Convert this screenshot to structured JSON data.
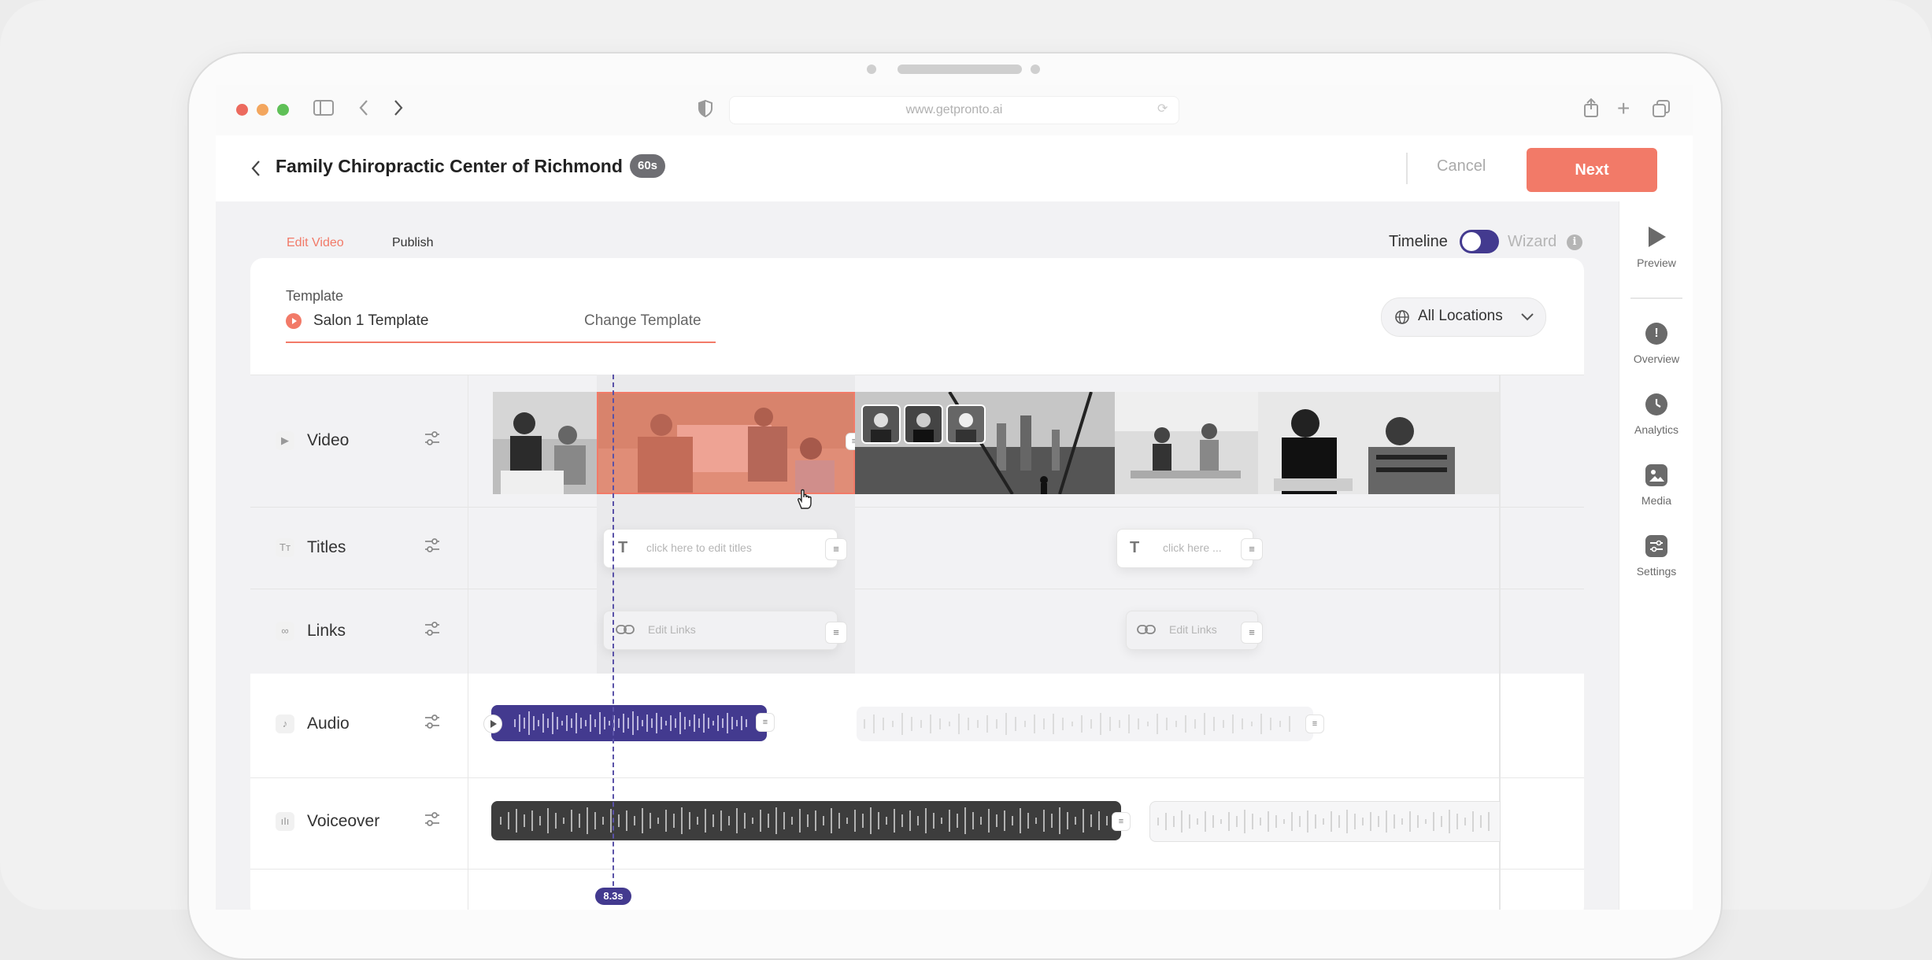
{
  "browser": {
    "url": "www.getpronto.ai"
  },
  "header": {
    "title": "Family Chiropractic Center of Richmond",
    "duration_badge": "60s",
    "cancel_label": "Cancel",
    "next_label": "Next"
  },
  "tabs": [
    {
      "label": "Edit Video",
      "active": true
    },
    {
      "label": "Publish",
      "active": false
    }
  ],
  "mode_toggle": {
    "left_label": "Timeline",
    "right_label": "Wizard",
    "on": "Timeline"
  },
  "template": {
    "heading": "Template",
    "name": "Salon 1 Template",
    "change_label": "Change Template"
  },
  "locations": {
    "label": "All Locations"
  },
  "tracks": {
    "video": {
      "label": "Video"
    },
    "titles": {
      "label": "Titles",
      "chip1": "click here to edit titles",
      "chip2": "click here ..."
    },
    "links": {
      "label": "Links",
      "chip1": "Edit Links",
      "chip2": "Edit Links"
    },
    "audio": {
      "label": "Audio"
    },
    "voiceover": {
      "label": "Voiceover"
    }
  },
  "playhead": {
    "time": "8.3s"
  },
  "rail": [
    {
      "label": "Preview",
      "icon": "play-icon"
    },
    {
      "label": "Overview",
      "icon": "alert-circle-icon"
    },
    {
      "label": "Analytics",
      "icon": "clock-icon"
    },
    {
      "label": "Media",
      "icon": "image-icon"
    },
    {
      "label": "Settings",
      "icon": "sliders-icon"
    }
  ],
  "colors": {
    "accent": "#f27a68",
    "purple": "#433a8f",
    "dark_track": "#3d3d3d"
  }
}
